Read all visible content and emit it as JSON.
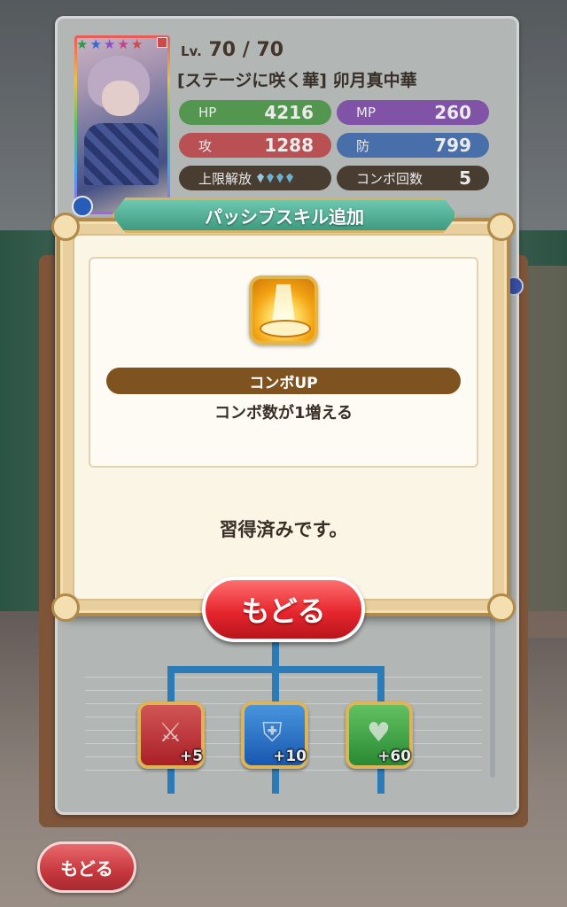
{
  "character": {
    "stars": 5,
    "star_colors": [
      "#2fa84f",
      "#3f6fe0",
      "#9a55d8",
      "#d64a8f",
      "#e05050"
    ],
    "level_label": "Lv.",
    "level": "70 / 70",
    "name": "[ステージに咲く華] 卯月真中華",
    "stats": {
      "hp_label": "HP",
      "hp_value": "4216",
      "mp_label": "MP",
      "mp_value": "260",
      "atk_label": "攻",
      "atk_value": "1288",
      "def_label": "防",
      "def_value": "799",
      "limit_break_label": "上限解放",
      "limit_break_gems": 4,
      "combo_label": "コンボ回数",
      "combo_value": "5"
    }
  },
  "dialog": {
    "title": "パッシブスキル追加",
    "skill_icon": "combo-up-icon",
    "skill_name": "コンボUP",
    "skill_description": "コンボ数が1増える",
    "status_message": "習得済みです。",
    "back_button": "もどる"
  },
  "skill_tree": {
    "nodes": [
      {
        "type": "attack",
        "icon": "sword-icon",
        "bonus": "+5"
      },
      {
        "type": "defense",
        "icon": "shield-icon",
        "bonus": "+10"
      },
      {
        "type": "hp",
        "icon": "heart-icon",
        "bonus": "+60"
      }
    ]
  },
  "footer": {
    "back_button": "もどる"
  },
  "colors": {
    "hp": "#5aa357",
    "mp": "#8c5bb6",
    "atk": "#c9585c",
    "def": "#4f79b8",
    "banner": "#3f9a82",
    "button_red": "#e6262e"
  }
}
